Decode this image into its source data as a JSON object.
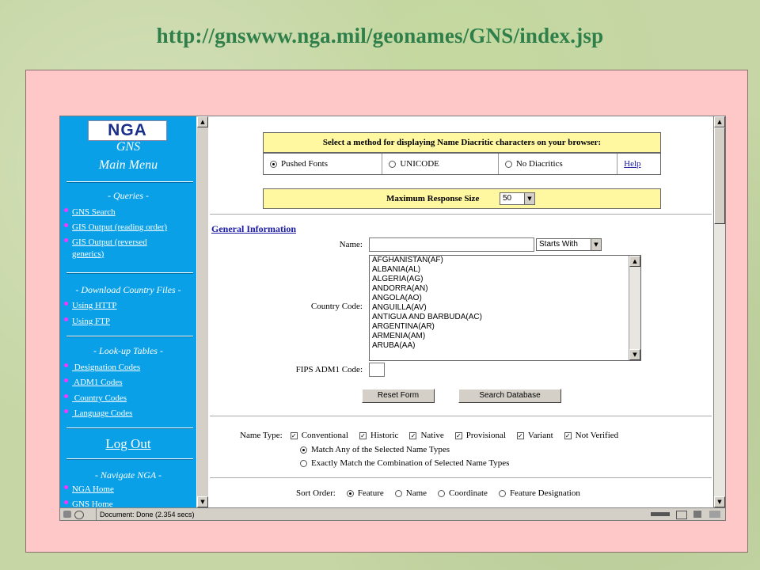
{
  "slide": {
    "title": "http://gnswww.nga.mil/geonames/GNS/index.jsp"
  },
  "left_menu": {
    "logo": "NGA",
    "title": "GNS",
    "subtitle": "Main Menu",
    "queries_header": "- Queries -",
    "queries": [
      "GNS Search",
      "GIS Output (reading order)",
      "GIS Output (reversed",
      "generics)"
    ],
    "download_header": "- Download Country Files -",
    "download": [
      "Using HTTP",
      "Using FTP"
    ],
    "lookup_header": "- Look-up Tables -",
    "lookup": [
      "Designation Codes",
      "ADM1 Codes",
      "Country Codes",
      "Language Codes"
    ],
    "logout": "Log Out",
    "navigate_header": "- Navigate NGA -",
    "navigate": [
      "NGA Home",
      "GNS Home"
    ]
  },
  "diacritics": {
    "header": "Select a method for displaying Name Diacritic characters on your browser:",
    "options": [
      "Pushed Fonts",
      "UNICODE",
      "No Diacritics"
    ],
    "selected": "Pushed Fonts",
    "help": "Help"
  },
  "max_response": {
    "label": "Maximum Response Size",
    "value": "50"
  },
  "general_info": {
    "header": "General Information",
    "name_label": "Name:",
    "name_value": "",
    "name_mode": "Starts With",
    "country_label": "Country Code:",
    "countries": [
      "AFGHANISTAN(AF)",
      "ALBANIA(AL)",
      "ALGERIA(AG)",
      "ANDORRA(AN)",
      "ANGOLA(AO)",
      "ANGUILLA(AV)",
      "ANTIGUA AND BARBUDA(AC)",
      "ARGENTINA(AR)",
      "ARMENIA(AM)",
      "ARUBA(AA)"
    ],
    "fips_label": "FIPS ADM1 Code:",
    "reset_button": "Reset Form",
    "search_button": "Search Database"
  },
  "name_type": {
    "label": "Name Type:",
    "types": [
      "Conventional",
      "Historic",
      "Native",
      "Provisional",
      "Variant",
      "Not Verified"
    ],
    "match_any": "Match Any of the Selected Name Types",
    "match_exact": "Exactly Match the Combination of Selected Name Types"
  },
  "sort_order": {
    "label": "Sort Order:",
    "options": [
      "Feature",
      "Name",
      "Coordinate",
      "Feature Designation"
    ],
    "selected": "Feature"
  },
  "status_bar": {
    "text": "Document: Done (2.354 secs)"
  }
}
